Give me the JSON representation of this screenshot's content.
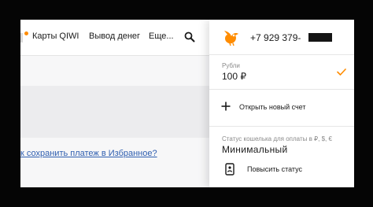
{
  "nav": {
    "items": [
      "Карты QIWI",
      "Вывод денег",
      "Еще..."
    ],
    "accent_color": "#ff8c00"
  },
  "content": {
    "favorite_link": "к сохранить платеж в Избранное?"
  },
  "account_panel": {
    "avatar_icon": "qiwi-bird-icon",
    "phone": "+7 929 379-",
    "balance_label": "Рубли",
    "balance_value": "100 ₽",
    "open_account_label": "Открыть новый счет",
    "wallet_status_label": "Статус кошелька для оплаты в ₽, $, €",
    "wallet_status_value": "Минимальный",
    "upgrade_status_label": "Повысить статус"
  }
}
